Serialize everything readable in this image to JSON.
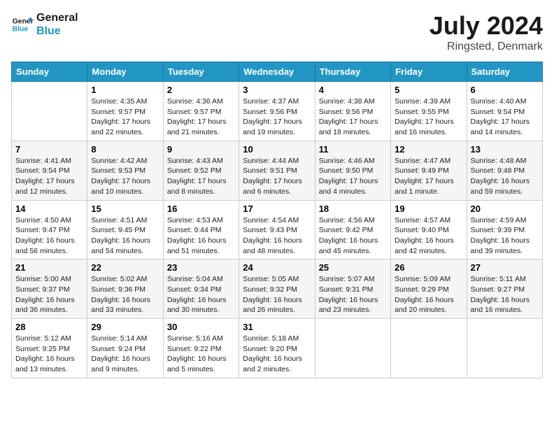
{
  "header": {
    "logo_line1": "General",
    "logo_line2": "Blue",
    "month_year": "July 2024",
    "location": "Ringsted, Denmark"
  },
  "weekdays": [
    "Sunday",
    "Monday",
    "Tuesday",
    "Wednesday",
    "Thursday",
    "Friday",
    "Saturday"
  ],
  "weeks": [
    [
      {
        "day": "",
        "info": ""
      },
      {
        "day": "1",
        "info": "Sunrise: 4:35 AM\nSunset: 9:57 PM\nDaylight: 17 hours and 22 minutes."
      },
      {
        "day": "2",
        "info": "Sunrise: 4:36 AM\nSunset: 9:57 PM\nDaylight: 17 hours and 21 minutes."
      },
      {
        "day": "3",
        "info": "Sunrise: 4:37 AM\nSunset: 9:56 PM\nDaylight: 17 hours and 19 minutes."
      },
      {
        "day": "4",
        "info": "Sunrise: 4:38 AM\nSunset: 9:56 PM\nDaylight: 17 hours and 18 minutes."
      },
      {
        "day": "5",
        "info": "Sunrise: 4:39 AM\nSunset: 9:55 PM\nDaylight: 17 hours and 16 minutes."
      },
      {
        "day": "6",
        "info": "Sunrise: 4:40 AM\nSunset: 9:54 PM\nDaylight: 17 hours and 14 minutes."
      }
    ],
    [
      {
        "day": "7",
        "info": "Sunrise: 4:41 AM\nSunset: 9:54 PM\nDaylight: 17 hours and 12 minutes."
      },
      {
        "day": "8",
        "info": "Sunrise: 4:42 AM\nSunset: 9:53 PM\nDaylight: 17 hours and 10 minutes."
      },
      {
        "day": "9",
        "info": "Sunrise: 4:43 AM\nSunset: 9:52 PM\nDaylight: 17 hours and 8 minutes."
      },
      {
        "day": "10",
        "info": "Sunrise: 4:44 AM\nSunset: 9:51 PM\nDaylight: 17 hours and 6 minutes."
      },
      {
        "day": "11",
        "info": "Sunrise: 4:46 AM\nSunset: 9:50 PM\nDaylight: 17 hours and 4 minutes."
      },
      {
        "day": "12",
        "info": "Sunrise: 4:47 AM\nSunset: 9:49 PM\nDaylight: 17 hours and 1 minute."
      },
      {
        "day": "13",
        "info": "Sunrise: 4:48 AM\nSunset: 9:48 PM\nDaylight: 16 hours and 59 minutes."
      }
    ],
    [
      {
        "day": "14",
        "info": "Sunrise: 4:50 AM\nSunset: 9:47 PM\nDaylight: 16 hours and 56 minutes."
      },
      {
        "day": "15",
        "info": "Sunrise: 4:51 AM\nSunset: 9:45 PM\nDaylight: 16 hours and 54 minutes."
      },
      {
        "day": "16",
        "info": "Sunrise: 4:53 AM\nSunset: 9:44 PM\nDaylight: 16 hours and 51 minutes."
      },
      {
        "day": "17",
        "info": "Sunrise: 4:54 AM\nSunset: 9:43 PM\nDaylight: 16 hours and 48 minutes."
      },
      {
        "day": "18",
        "info": "Sunrise: 4:56 AM\nSunset: 9:42 PM\nDaylight: 16 hours and 45 minutes."
      },
      {
        "day": "19",
        "info": "Sunrise: 4:57 AM\nSunset: 9:40 PM\nDaylight: 16 hours and 42 minutes."
      },
      {
        "day": "20",
        "info": "Sunrise: 4:59 AM\nSunset: 9:39 PM\nDaylight: 16 hours and 39 minutes."
      }
    ],
    [
      {
        "day": "21",
        "info": "Sunrise: 5:00 AM\nSunset: 9:37 PM\nDaylight: 16 hours and 36 minutes."
      },
      {
        "day": "22",
        "info": "Sunrise: 5:02 AM\nSunset: 9:36 PM\nDaylight: 16 hours and 33 minutes."
      },
      {
        "day": "23",
        "info": "Sunrise: 5:04 AM\nSunset: 9:34 PM\nDaylight: 16 hours and 30 minutes."
      },
      {
        "day": "24",
        "info": "Sunrise: 5:05 AM\nSunset: 9:32 PM\nDaylight: 16 hours and 26 minutes."
      },
      {
        "day": "25",
        "info": "Sunrise: 5:07 AM\nSunset: 9:31 PM\nDaylight: 16 hours and 23 minutes."
      },
      {
        "day": "26",
        "info": "Sunrise: 5:09 AM\nSunset: 9:29 PM\nDaylight: 16 hours and 20 minutes."
      },
      {
        "day": "27",
        "info": "Sunrise: 5:11 AM\nSunset: 9:27 PM\nDaylight: 16 hours and 16 minutes."
      }
    ],
    [
      {
        "day": "28",
        "info": "Sunrise: 5:12 AM\nSunset: 9:25 PM\nDaylight: 16 hours and 13 minutes."
      },
      {
        "day": "29",
        "info": "Sunrise: 5:14 AM\nSunset: 9:24 PM\nDaylight: 16 hours and 9 minutes."
      },
      {
        "day": "30",
        "info": "Sunrise: 5:16 AM\nSunset: 9:22 PM\nDaylight: 16 hours and 5 minutes."
      },
      {
        "day": "31",
        "info": "Sunrise: 5:18 AM\nSunset: 9:20 PM\nDaylight: 16 hours and 2 minutes."
      },
      {
        "day": "",
        "info": ""
      },
      {
        "day": "",
        "info": ""
      },
      {
        "day": "",
        "info": ""
      }
    ]
  ]
}
